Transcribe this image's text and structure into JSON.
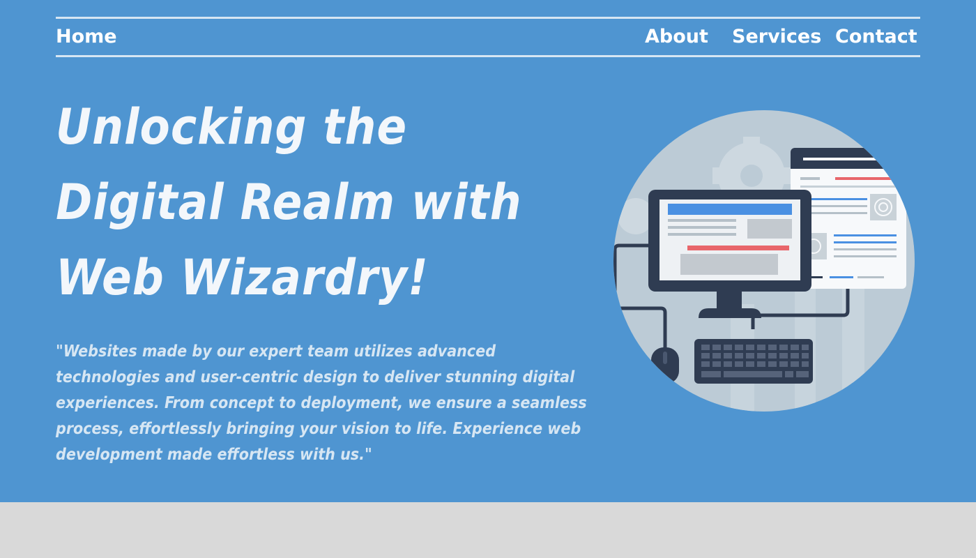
{
  "nav": {
    "home": "Home",
    "about": "About",
    "services": "Services",
    "contact": "Contact"
  },
  "hero": {
    "title": "Unlocking the Digital Realm with Web Wizardry!",
    "quote": "\"Websites made by our expert team utilizes advanced technologies and user-centric design to deliver stunning digital experiences. From concept to deployment, we ensure a seamless process, effortlessly bringing your vision to life. Experience web development made effortless with us.\""
  },
  "colors": {
    "hero_background": "#4f95d1",
    "page_background": "#d9d9d9",
    "nav_border": "#d6e6f3",
    "illustration_circle": "#bccbd6",
    "device_dark": "#2f3c52",
    "accent_blue": "#4a90e2",
    "accent_red": "#e8666b"
  },
  "illustration": {
    "icon": "web-development-illustration"
  }
}
